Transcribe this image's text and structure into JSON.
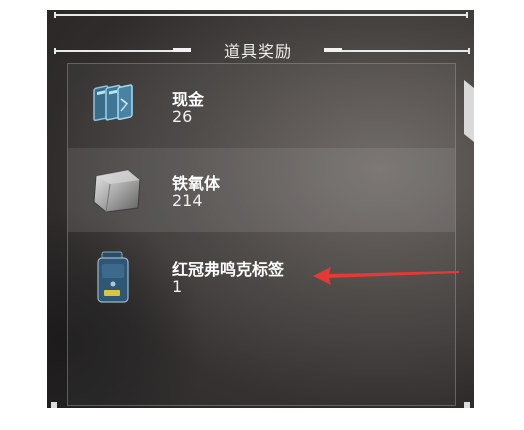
{
  "section_title": "道具奖励",
  "items": [
    {
      "name": "现金",
      "qty": "26",
      "icon": "cash-cards-icon"
    },
    {
      "name": "铁氧体",
      "qty": "214",
      "icon": "ferrite-ore-icon"
    },
    {
      "name": "红冠弗鸣克标签",
      "qty": "1",
      "icon": "tag-device-icon"
    }
  ],
  "colors": {
    "panel_bg": "#3a3736",
    "highlight_row": "#5a5654",
    "text": "#ffffff",
    "arrow": "#e53935"
  }
}
